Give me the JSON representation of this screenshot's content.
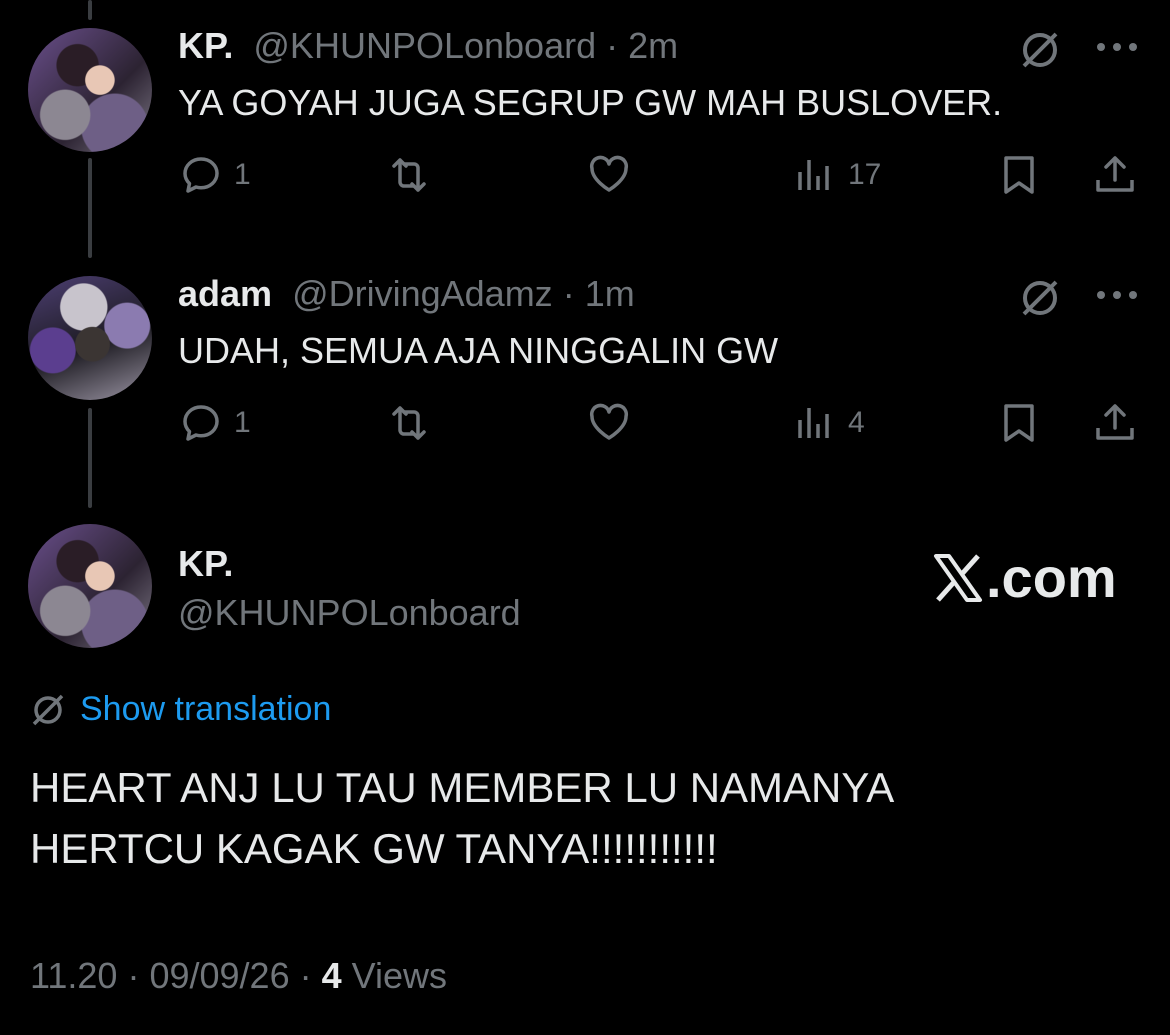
{
  "replies": [
    {
      "name": "KP.",
      "handle": "@KHUNPOLonboard",
      "separator": "·",
      "time": "2m",
      "text": "YA GOYAH JUGA SEGRUP GW MAH BUSLOVER.",
      "replies_count": "1",
      "views_count": "17",
      "avatar": "kp-avatar"
    },
    {
      "name": "adam",
      "handle": "@DrivingAdamz",
      "separator": "·",
      "time": "1m",
      "text": "UDAH, SEMUA AJA NINGGALIN GW",
      "replies_count": "1",
      "views_count": "4",
      "avatar": "adam-avatar"
    }
  ],
  "main_tweet": {
    "name": "KP.",
    "handle": "@KHUNPOLonboard",
    "brand": ".com",
    "translate_label": "Show translation",
    "text_line1": "HEART ANJ LU TAU MEMBER LU NAMANYA",
    "text_line2": "HERTCU KAGAK GW TANYA!!!!!!!!!!!",
    "time": "11.20",
    "separator": "·",
    "date": "09/09/26",
    "views_count": "4",
    "views_label": "Views"
  },
  "icons": [
    "grok-icon",
    "more-icon",
    "reply-icon",
    "retweet-icon",
    "like-icon",
    "views-icon",
    "bookmark-icon",
    "share-icon",
    "x-logo-icon",
    "translate-icon"
  ],
  "colors": {
    "background": "#000000",
    "text": "#e7e9ea",
    "muted": "#71767b",
    "link": "#1d9bf0",
    "thread_line": "#3a3d41"
  }
}
